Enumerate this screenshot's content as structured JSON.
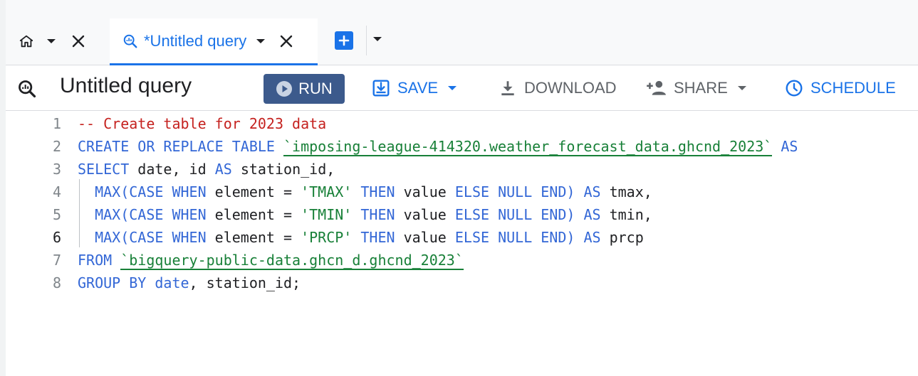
{
  "tabs": {
    "home_tab": {
      "icon": "home-icon"
    },
    "active_tab": {
      "title": "*Untitled query",
      "icon": "query-icon"
    },
    "add_tab": {
      "icon": "plus-icon"
    }
  },
  "toolbar": {
    "title": "Untitled query",
    "run_label": "RUN",
    "save_label": "SAVE",
    "download_label": "DOWNLOAD",
    "share_label": "SHARE",
    "schedule_label": "SCHEDULE"
  },
  "colors": {
    "accent": "#1a73e8",
    "run_button": "#3c5a8c",
    "keyword": "#3367d6",
    "string": "#188038",
    "comment": "#c5221f"
  },
  "editor": {
    "active_line": 6,
    "lines": [
      {
        "num": "1",
        "tokens": [
          {
            "t": "comment",
            "v": "-- Create table for 2023 data"
          }
        ]
      },
      {
        "num": "2",
        "tokens": [
          {
            "t": "kw",
            "v": "CREATE OR REPLACE TABLE "
          },
          {
            "t": "tbl",
            "v": "`imposing-league-414320.weather_forecast_data.ghcnd_2023`"
          },
          {
            "t": "kw",
            "v": " AS"
          }
        ]
      },
      {
        "num": "3",
        "tokens": [
          {
            "t": "kw",
            "v": "SELECT "
          },
          {
            "t": "plain",
            "v": "date"
          },
          {
            "t": "plain",
            "v": ", id "
          },
          {
            "t": "kw",
            "v": "AS"
          },
          {
            "t": "plain",
            "v": " station_id,"
          }
        ]
      },
      {
        "num": "4",
        "tokens": [
          {
            "t": "plain",
            "v": "  "
          },
          {
            "t": "kw",
            "v": "MAX(CASE WHEN"
          },
          {
            "t": "plain",
            "v": " element = "
          },
          {
            "t": "str",
            "v": "'TMAX'"
          },
          {
            "t": "kw",
            "v": " THEN"
          },
          {
            "t": "plain",
            "v": " value "
          },
          {
            "t": "kw",
            "v": "ELSE NULL END) AS"
          },
          {
            "t": "plain",
            "v": " tmax,"
          }
        ]
      },
      {
        "num": "5",
        "tokens": [
          {
            "t": "plain",
            "v": "  "
          },
          {
            "t": "kw",
            "v": "MAX(CASE WHEN"
          },
          {
            "t": "plain",
            "v": " element = "
          },
          {
            "t": "str",
            "v": "'TMIN'"
          },
          {
            "t": "kw",
            "v": " THEN"
          },
          {
            "t": "plain",
            "v": " value "
          },
          {
            "t": "kw",
            "v": "ELSE NULL END) AS"
          },
          {
            "t": "plain",
            "v": " tmin,"
          }
        ]
      },
      {
        "num": "6",
        "tokens": [
          {
            "t": "plain",
            "v": "  "
          },
          {
            "t": "kw",
            "v": "MAX(CASE WHEN"
          },
          {
            "t": "plain",
            "v": " element = "
          },
          {
            "t": "str",
            "v": "'PRCP'"
          },
          {
            "t": "kw",
            "v": " THEN"
          },
          {
            "t": "plain",
            "v": " value "
          },
          {
            "t": "kw",
            "v": "ELSE NULL END) AS"
          },
          {
            "t": "plain",
            "v": " prcp"
          }
        ]
      },
      {
        "num": "7",
        "tokens": [
          {
            "t": "kw",
            "v": "FROM "
          },
          {
            "t": "tbl",
            "v": "`bigquery-public-data.ghcn_d.ghcnd_2023`"
          }
        ]
      },
      {
        "num": "8",
        "tokens": [
          {
            "t": "kw",
            "v": "GROUP BY"
          },
          {
            "t": "kw",
            "v": " date"
          },
          {
            "t": "plain",
            "v": ", station_id;"
          }
        ]
      }
    ]
  }
}
